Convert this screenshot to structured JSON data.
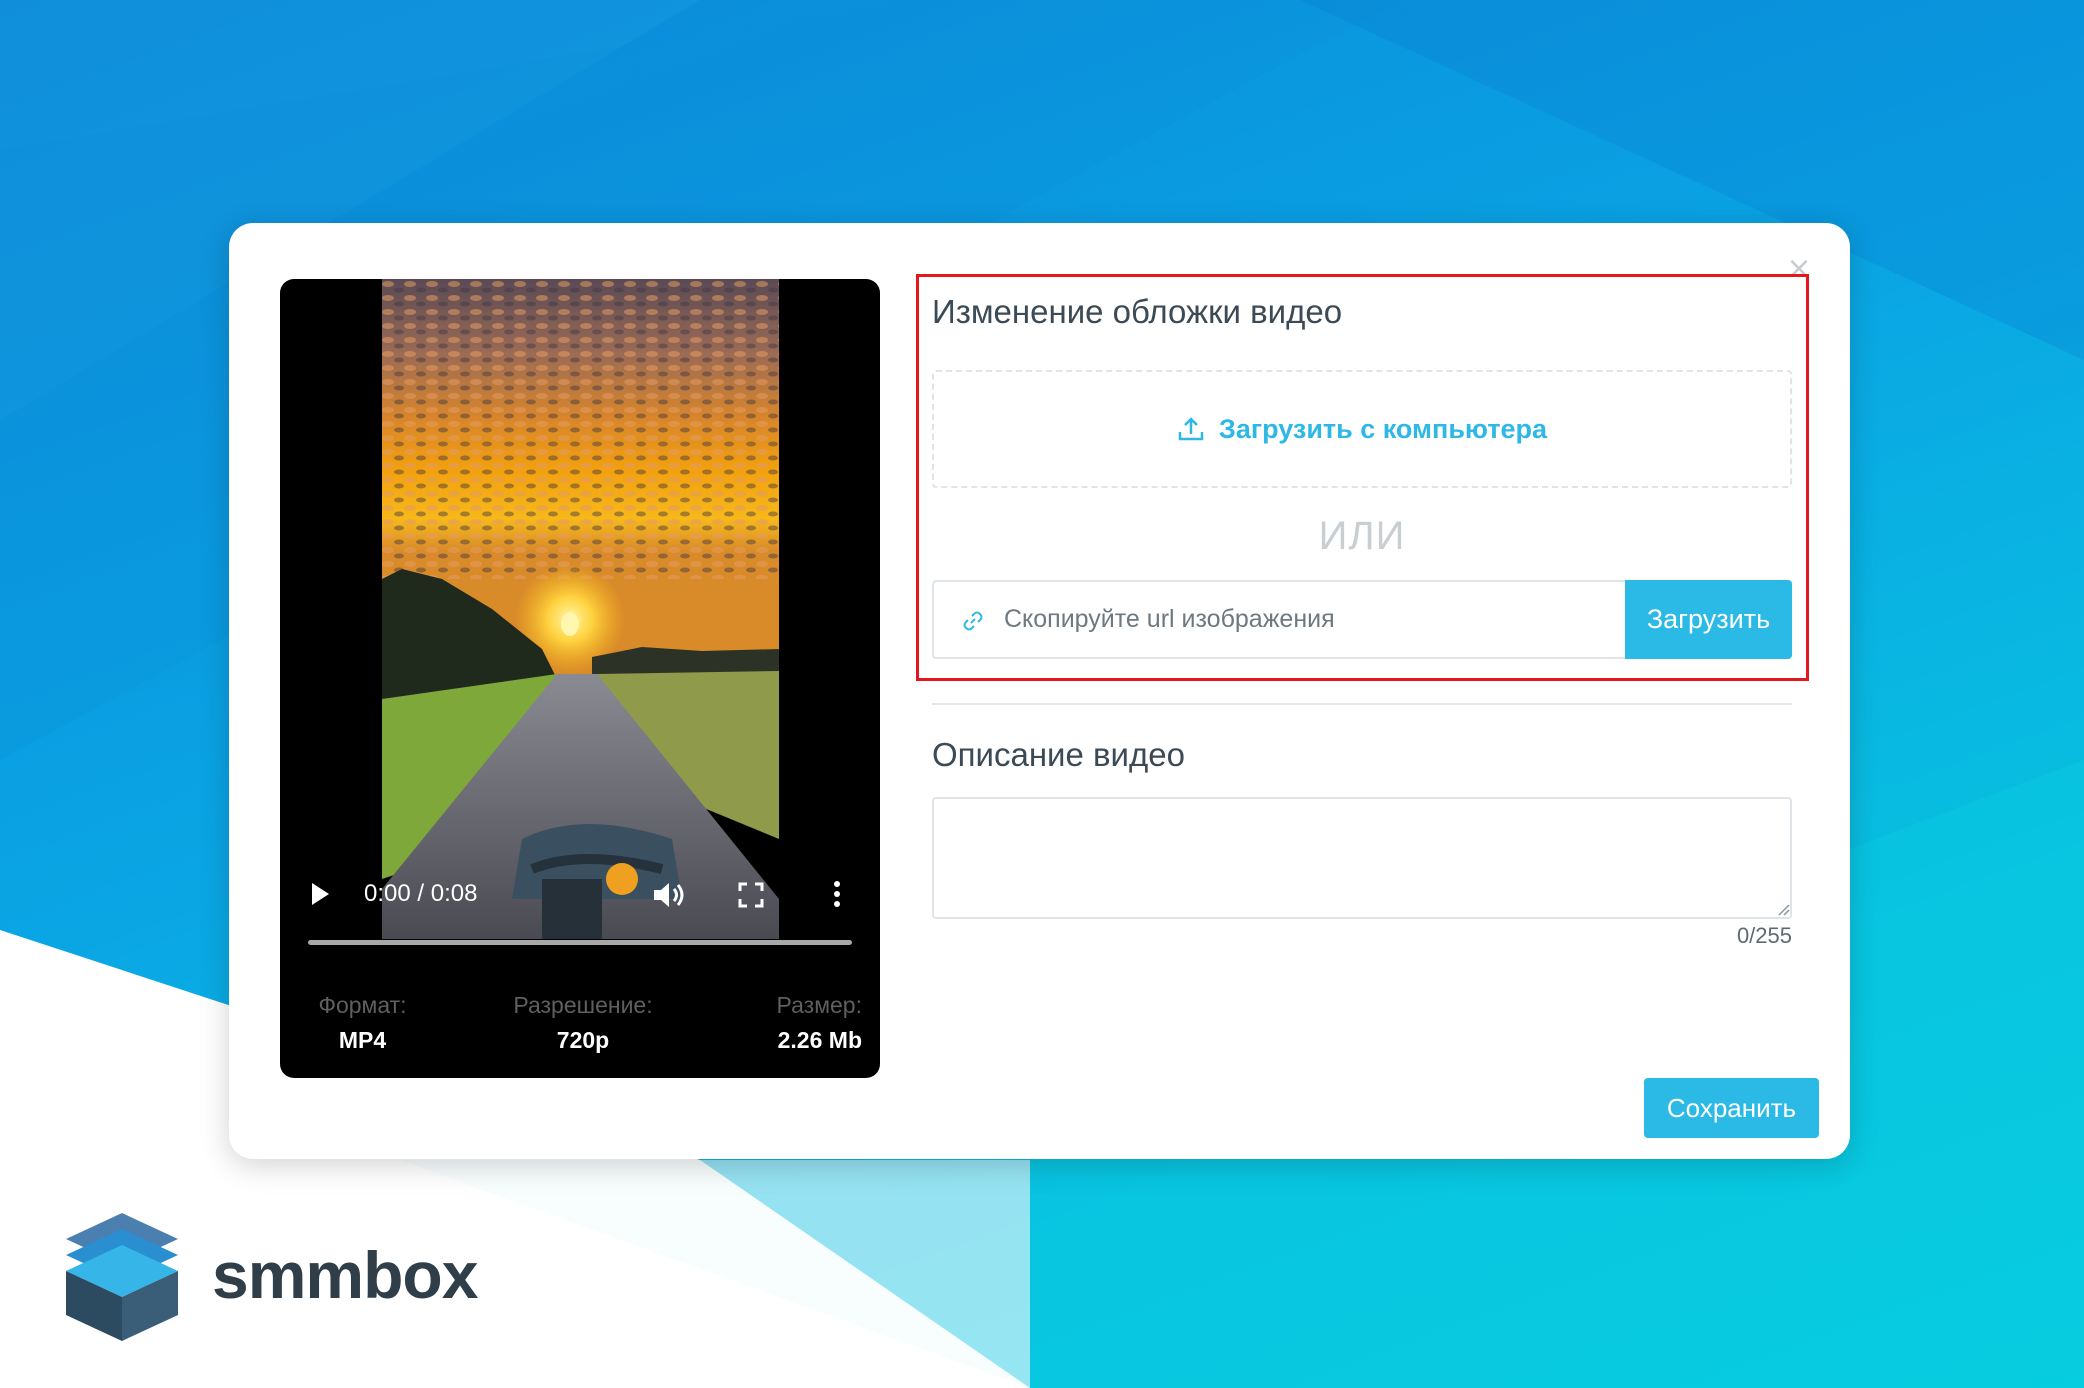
{
  "colors": {
    "accent": "#2bb9e6",
    "highlight": "#e4161e",
    "text_dark": "#3c4a55",
    "brand_dark": "#2f3e48"
  },
  "modal": {
    "close_icon": "close-icon"
  },
  "player": {
    "time_display": "0:00 / 0:08",
    "progress": 0.0,
    "icons": [
      "play-icon",
      "volume-icon",
      "fullscreen-icon",
      "more-vertical-icon"
    ]
  },
  "video_meta": {
    "format_label": "Формат:",
    "format_value": "MP4",
    "resolution_label": "Разрешение:",
    "resolution_value": "720p",
    "size_label": "Размер:",
    "size_value": "2.26 Mb"
  },
  "cover": {
    "title": "Изменение обложки видео",
    "upload_computer_label": "Загрузить с компьютера",
    "upload_icon": "upload-icon",
    "or_label": "ИЛИ",
    "url_placeholder": "Скопируйте url изображения",
    "url_value": "",
    "link_icon": "link-icon",
    "url_button_label": "Загрузить"
  },
  "description": {
    "title": "Описание видео",
    "value": "",
    "counter": "0/255"
  },
  "footer": {
    "save_label": "Сохранить"
  },
  "brand": {
    "name": "smmbox"
  }
}
